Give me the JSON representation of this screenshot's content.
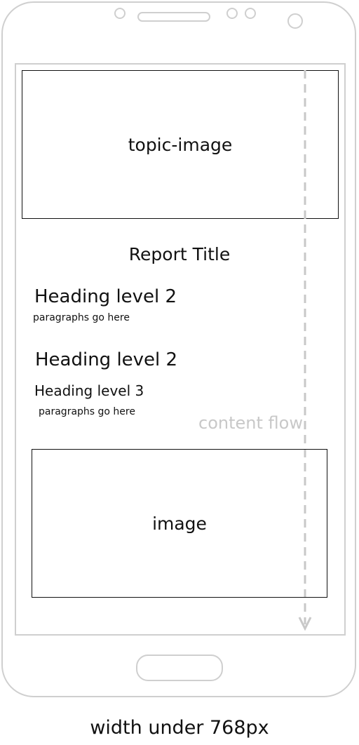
{
  "topic_image_label": "topic-image",
  "report_title": "Report Title",
  "heading_2_first": "Heading level 2",
  "paragraph_first": "paragraphs go here",
  "heading_2_second": "Heading level 2",
  "heading_3": "Heading level 3",
  "paragraph_second": "paragraphs go here",
  "image_label": "image",
  "flow_label": "content flow",
  "footer_label": "width under 768px",
  "colors": {
    "outline": "#cfcfcf",
    "ink": "#111111",
    "flow": "#c8c8c8"
  }
}
